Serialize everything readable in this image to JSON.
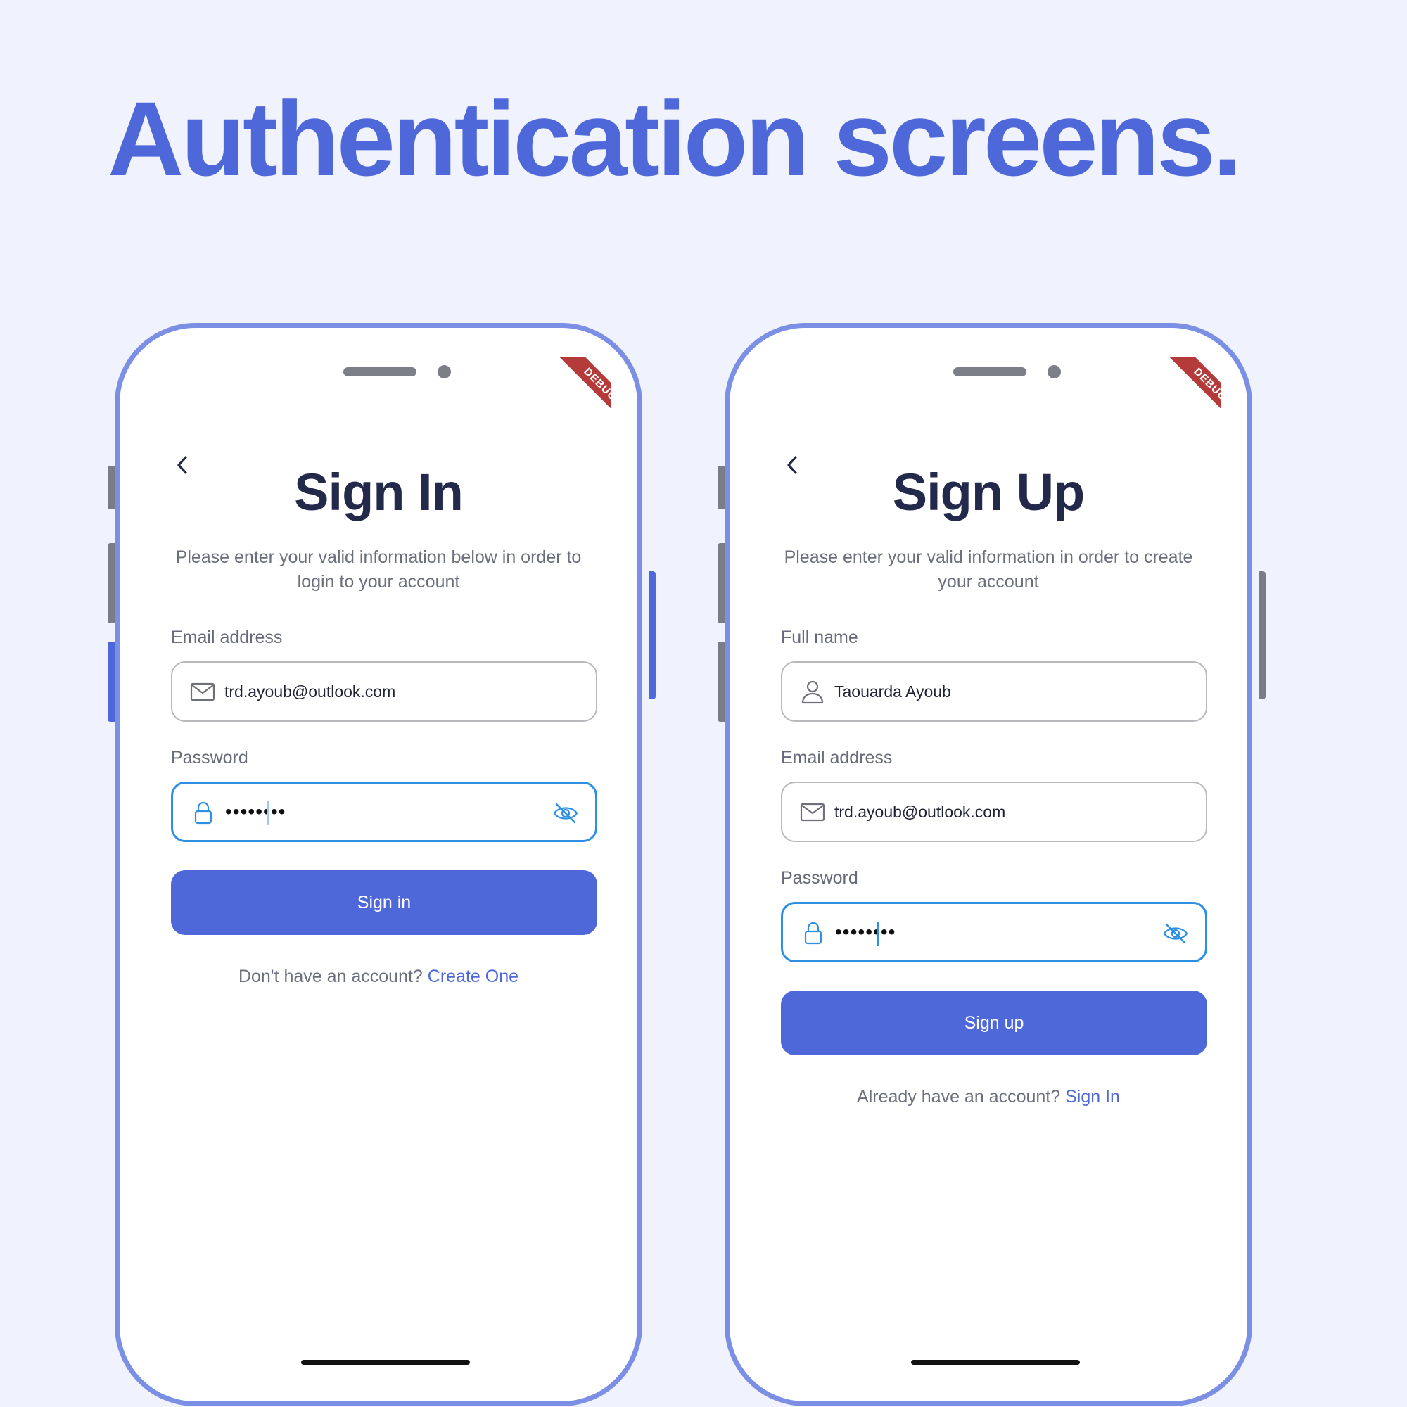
{
  "headline": "Authentication screens.",
  "colors": {
    "background": "#f0f3fe",
    "accent": "#4e68da",
    "phone_frame": "#7b8fe4",
    "focus_border": "#2f90e3",
    "title_text": "#23294b",
    "debug_ribbon": "#b53b3b"
  },
  "signin": {
    "debug_badge": "DEBUG",
    "back_icon": "chevron-left-icon",
    "title": "Sign In",
    "subtitle": "Please enter your valid information below in order to login to your account",
    "email": {
      "label": "Email address",
      "value": "trd.ayoub@outlook.com",
      "icon": "mail-icon"
    },
    "password": {
      "label": "Password",
      "value": "••••••••",
      "icon": "lock-icon",
      "toggle_icon": "eye-off-icon"
    },
    "button": "Sign in",
    "footer_text": "Don't have an account?",
    "footer_link": "Create One"
  },
  "signup": {
    "debug_badge": "DEBUG",
    "back_icon": "chevron-left-icon",
    "title": "Sign Up",
    "subtitle": "Please enter your valid information in order to create your account",
    "fullname": {
      "label": "Full name",
      "value": "Taouarda Ayoub",
      "icon": "user-icon"
    },
    "email": {
      "label": "Email address",
      "value": "trd.ayoub@outlook.com",
      "icon": "mail-icon"
    },
    "password": {
      "label": "Password",
      "value": "••••••••",
      "icon": "lock-icon",
      "toggle_icon": "eye-off-icon"
    },
    "button": "Sign up",
    "footer_text": "Already have an account?",
    "footer_link": "Sign In"
  }
}
